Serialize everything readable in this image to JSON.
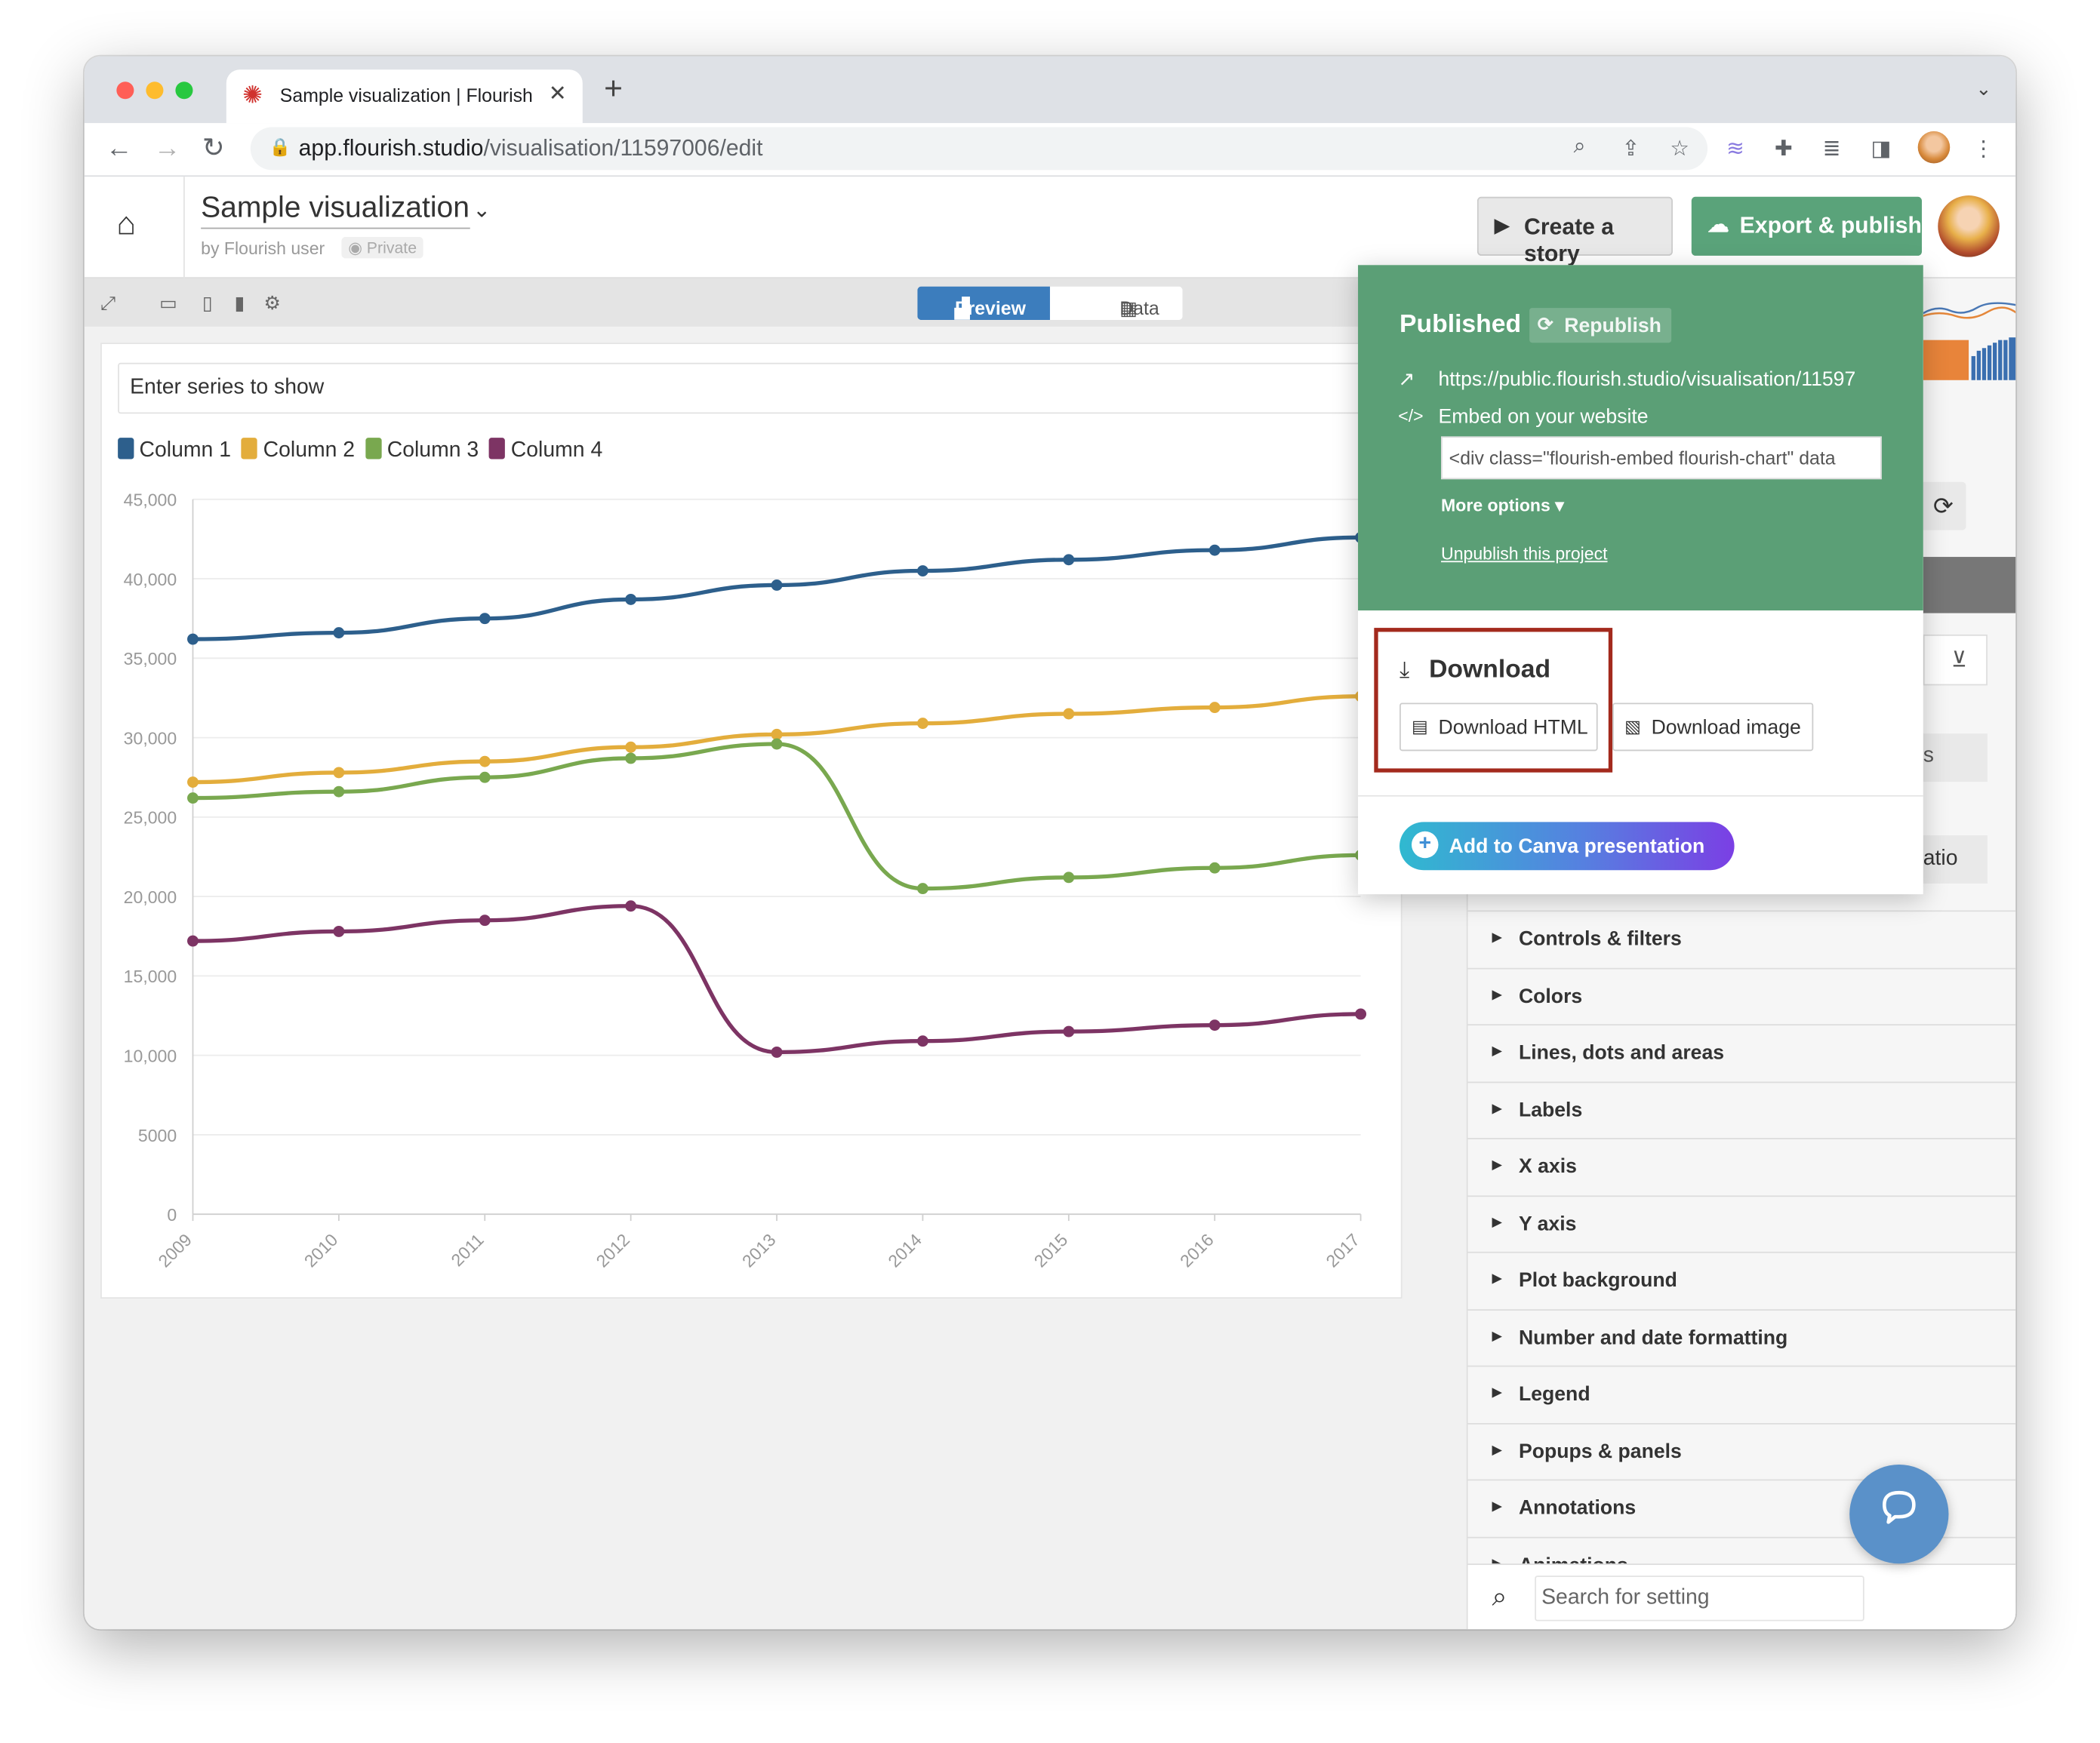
{
  "browser": {
    "tab_title": "Sample visualization | Flourish",
    "tab_close": "✕",
    "new_tab": "+",
    "url_host": "app.flourish.studio",
    "url_path": "/visualisation/11597006/edit"
  },
  "header": {
    "title": "Sample visualization",
    "byline": "by Flourish user",
    "privacy": "Private",
    "create_story_label": "Create a story",
    "export_label": "Export & publish"
  },
  "preview_toolbar": {
    "preview_label": "Preview",
    "data_label": "Data"
  },
  "chart": {
    "series_placeholder": "Enter series to show"
  },
  "chart_data": {
    "type": "line",
    "categories": [
      "2009",
      "2010",
      "2011",
      "2012",
      "2013",
      "2014",
      "2015",
      "2016",
      "2017"
    ],
    "ylim": [
      0,
      45000
    ],
    "y_ticks": [
      "0",
      "5000",
      "10,000",
      "15,000",
      "20,000",
      "25,000",
      "30,000",
      "35,000",
      "40,000",
      "45,000"
    ],
    "y_tick_values": [
      0,
      5000,
      10000,
      15000,
      20000,
      25000,
      30000,
      35000,
      40000,
      45000
    ],
    "grid": true,
    "legend_position": "top-left",
    "series": [
      {
        "name": "Column 1",
        "color": "#2d5f8c",
        "values": [
          36200,
          36600,
          37500,
          38700,
          39600,
          40500,
          41200,
          41800,
          42600
        ]
      },
      {
        "name": "Column 2",
        "color": "#e3ad3c",
        "values": [
          27200,
          27800,
          28500,
          29400,
          30200,
          30900,
          31500,
          31900,
          32600
        ]
      },
      {
        "name": "Column 3",
        "color": "#79a84f",
        "values": [
          26200,
          26600,
          27500,
          28700,
          29600,
          20500,
          21200,
          21800,
          22600
        ]
      },
      {
        "name": "Column 4",
        "color": "#7d3464",
        "values": [
          17200,
          17800,
          18500,
          19400,
          10200,
          10900,
          11500,
          11900,
          12600
        ]
      }
    ]
  },
  "export_menu": {
    "published_label": "Published",
    "republish_label": "Republish",
    "public_url": "https://public.flourish.studio/visualisation/11597",
    "embed_label": "Embed on your website",
    "embed_code": "<div class=\"flourish-embed flourish-chart\" data",
    "more_options_label": "More options ▾",
    "unpublish_label": "Unpublish this project",
    "download_title": "Download",
    "download_html_label": "Download HTML",
    "download_image_label": "Download image",
    "canva_label": "Add to Canva presentation"
  },
  "settings_panel": {
    "partial_button_1": "s",
    "partial_button_2": "atio",
    "sections": [
      {
        "label": "Controls & filters"
      },
      {
        "label": "Colors"
      },
      {
        "label": "Lines, dots and areas"
      },
      {
        "label": "Labels"
      },
      {
        "label": "X axis"
      },
      {
        "label": "Y axis"
      },
      {
        "label": "Plot background"
      },
      {
        "label": "Number and date formatting"
      },
      {
        "label": "Legend"
      },
      {
        "label": "Popups & panels"
      },
      {
        "label": "Annotations"
      },
      {
        "label": "Animations"
      }
    ],
    "search_placeholder": "Search for setting"
  }
}
